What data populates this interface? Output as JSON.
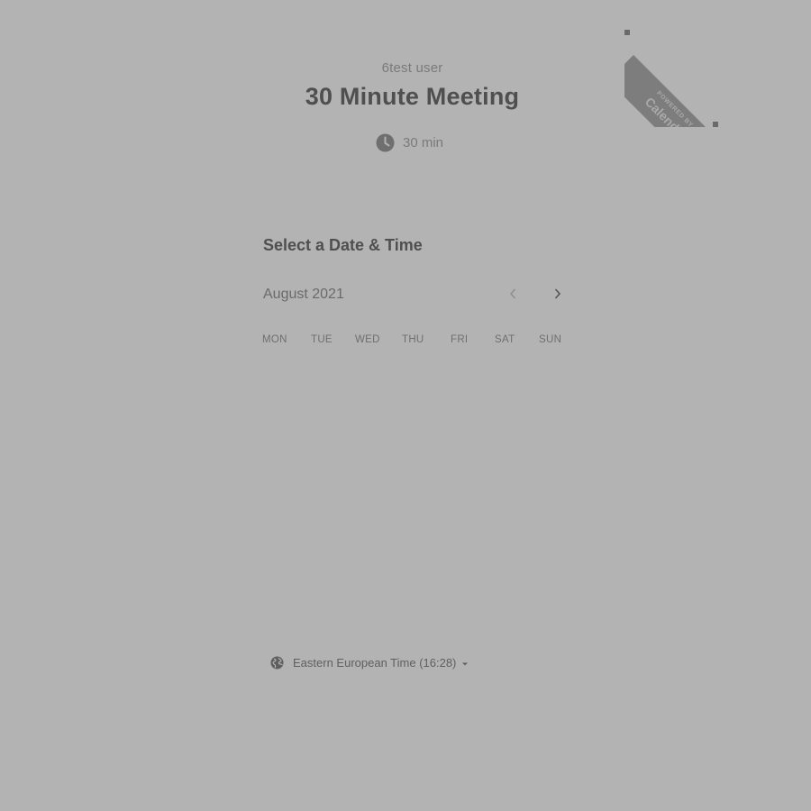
{
  "header": {
    "organizer": "6test user",
    "event_title": "30 Minute Meeting",
    "duration": "30 min"
  },
  "badge": {
    "line1": "POWERED BY",
    "line2": "Calendly"
  },
  "calendar": {
    "section_title": "Select a Date & Time",
    "month": "August 2021",
    "weekdays": [
      "MON",
      "TUE",
      "WED",
      "THU",
      "FRI",
      "SAT",
      "SUN"
    ]
  },
  "timezone": {
    "label": "Eastern European Time (16:28)"
  },
  "icons": {
    "duration": "clock-icon",
    "timezone": "globe-icon",
    "prev": "chevron-left-icon",
    "next": "chevron-right-icon",
    "dropdown": "caret-down-icon"
  },
  "colors": {
    "background": "#b3b3b3",
    "title": "#4f4f4f",
    "ribbon": "#7d7d7d"
  }
}
